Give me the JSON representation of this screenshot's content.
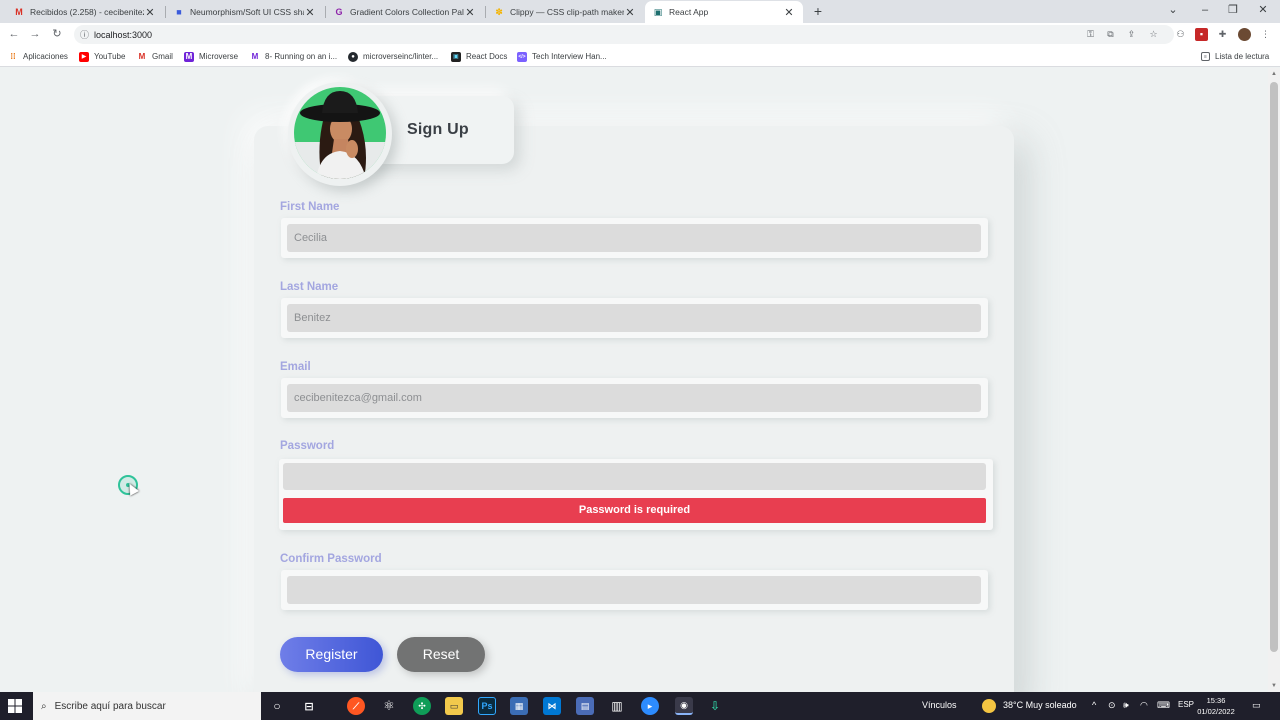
{
  "browser": {
    "tabs": [
      {
        "title": "Recibidos (2.258) - cecibenitezca",
        "icon": "gmail-icon",
        "color": "#d93025",
        "glyph": "M"
      },
      {
        "title": "Neumorphism/Soft UI CSS shado",
        "icon": "neumorphism-icon",
        "color": "#3b5bdb",
        "glyph": "■"
      },
      {
        "title": "Gradient Colors Collection Palett",
        "icon": "gradient-icon",
        "color": "#8e24aa",
        "glyph": "G"
      },
      {
        "title": "Clippy — CSS clip-path maker",
        "icon": "clippy-icon",
        "color": "#f4b400",
        "glyph": "✽"
      },
      {
        "title": "React App",
        "icon": "react-icon",
        "color": "#1e6f6f",
        "glyph": "▣"
      }
    ],
    "active_tab_index": 4,
    "url": "localhost:3000"
  },
  "bookmarks": [
    {
      "label": "Aplicaciones",
      "icon": "apps-grid-icon",
      "color": "#e8710a",
      "glyph": "⋮"
    },
    {
      "label": "YouTube",
      "icon": "youtube-icon",
      "color": "#ff0000",
      "glyph": "▶"
    },
    {
      "label": "Gmail",
      "icon": "gmail-icon",
      "color": "#d93025",
      "glyph": "M"
    },
    {
      "label": "Microverse",
      "icon": "microverse-icon",
      "color": "#6f23d8",
      "glyph": "M"
    },
    {
      "label": "8- Running on an i...",
      "icon": "microverse-course-icon",
      "color": "#6f23d8",
      "glyph": "M"
    },
    {
      "label": "microverseinc/linter...",
      "icon": "github-icon",
      "color": "#24292e",
      "glyph": "●"
    },
    {
      "label": "React Docs",
      "icon": "react-docs-icon",
      "color": "#222",
      "glyph": "▣"
    },
    {
      "label": "Tech Interview Han...",
      "icon": "tech-interview-icon",
      "color": "#7b61ff",
      "glyph": "</>"
    }
  ],
  "reading_list": "Lista de lectura",
  "form": {
    "title": "Sign Up",
    "first_name": {
      "label": "First Name",
      "value": "Cecilia"
    },
    "last_name": {
      "label": "Last Name",
      "value": "Benitez"
    },
    "email": {
      "label": "Email",
      "value": "cecibenitezca@gmail.com"
    },
    "password": {
      "label": "Password",
      "value": "",
      "error": "Password is required"
    },
    "confirm_password": {
      "label": "Confirm Password",
      "value": ""
    },
    "register_label": "Register",
    "reset_label": "Reset"
  },
  "taskbar": {
    "search_placeholder": "Escribe aquí para buscar",
    "links_label": "Vínculos",
    "weather": "38°C  Muy soleado",
    "language": "ESP",
    "time": "15:36",
    "date": "01/02/2022"
  },
  "colors": {
    "label": "#a3a6e0",
    "error": "#e83e50",
    "register_start": "#6f7ee8",
    "register_end": "#3f56d6",
    "reset": "#727373"
  }
}
